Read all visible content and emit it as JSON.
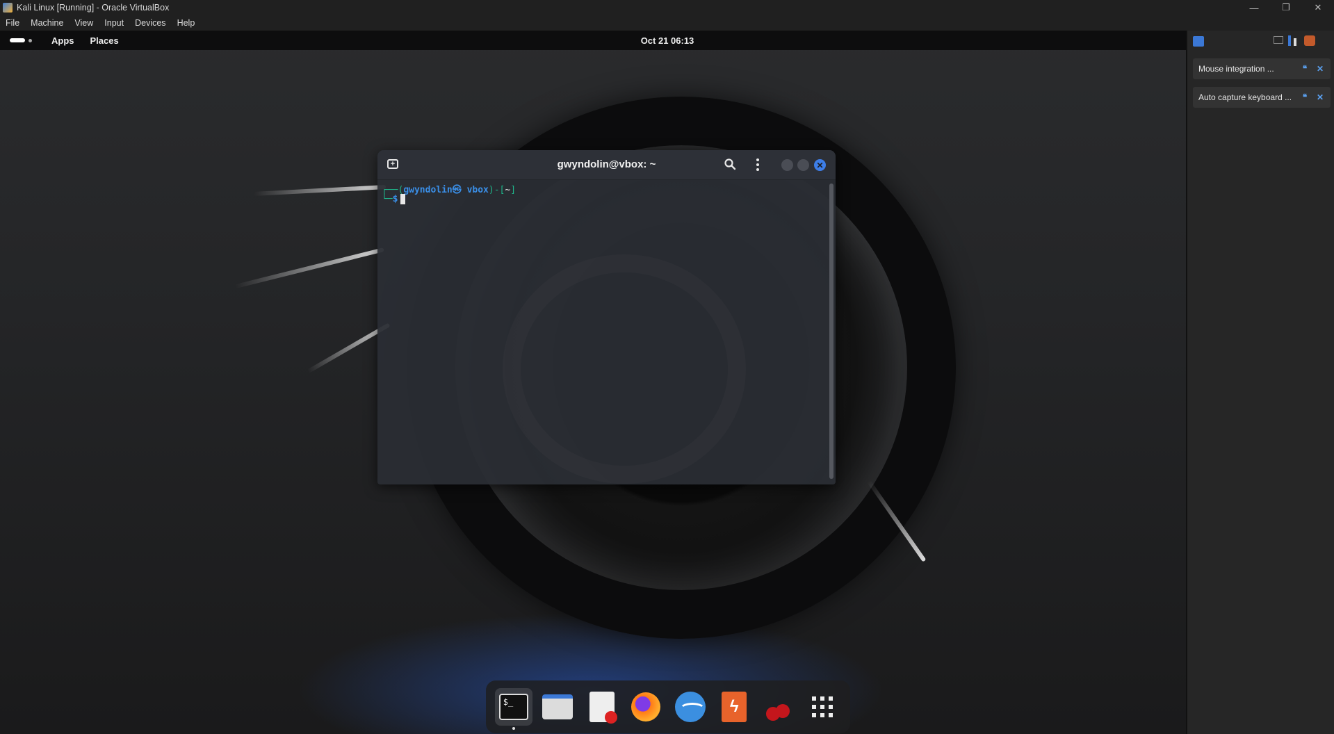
{
  "host_window": {
    "title": "Kali Linux [Running] - Oracle VirtualBox",
    "controls": [
      "—",
      "❐",
      "✕"
    ],
    "menu": [
      "File",
      "Machine",
      "View",
      "Input",
      "Devices",
      "Help"
    ]
  },
  "gnome_topbar": {
    "apps_label": "Apps",
    "places_label": "Places",
    "clock": "Oct 21  06:13"
  },
  "terminal": {
    "title": "gwyndolin@vbox: ~",
    "prompt_line1": {
      "corner": "┌──(",
      "user_host": "gwyndolin㉿ vbox",
      "sep": ")-[",
      "dir": "~",
      "close": "]"
    },
    "prompt_line2": {
      "corner": "└─",
      "symbol": "$"
    },
    "prompt_text": "$_"
  },
  "dock": {
    "items": [
      "terminal",
      "files",
      "text-editor",
      "firefox",
      "wireshark",
      "burp-suite",
      "cherrytree",
      "show-apps"
    ]
  },
  "notification_panel": {
    "notifications": [
      {
        "text": "Mouse integration ..."
      },
      {
        "text": "Auto capture keyboard ..."
      }
    ]
  },
  "colors": {
    "accent": "#3a8fe8",
    "prompt_green": "#1fb58a",
    "terminal_bg": "#2a2d34"
  }
}
